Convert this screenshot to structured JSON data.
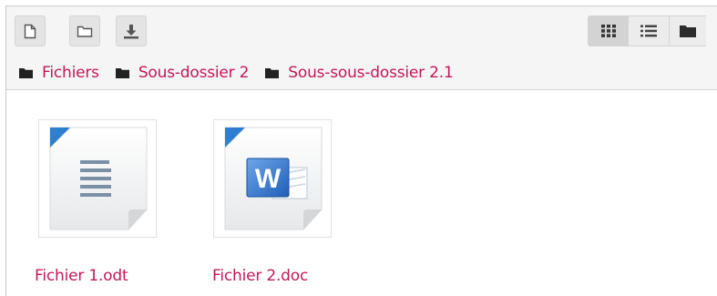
{
  "toolbar": {
    "buttons": [
      {
        "name": "add-file",
        "icon": "file-icon"
      },
      {
        "name": "create-folder",
        "icon": "folder-outline-icon"
      },
      {
        "name": "download",
        "icon": "download-icon"
      }
    ],
    "views": [
      {
        "name": "icons-view",
        "icon": "grid-icon",
        "active": true
      },
      {
        "name": "list-view",
        "icon": "list-icon",
        "active": false
      },
      {
        "name": "tree-view",
        "icon": "folder-solid-icon",
        "active": false
      }
    ]
  },
  "breadcrumb": [
    {
      "label": "Fichiers",
      "icon": "folder-icon"
    },
    {
      "label": "Sous-dossier 2",
      "icon": "folder-icon"
    },
    {
      "label": "Sous-sous-dossier 2.1",
      "icon": "folder-icon"
    }
  ],
  "files": [
    {
      "name": "Fichier 1.odt",
      "icon": "document-text-icon"
    },
    {
      "name": "Fichier 2.doc",
      "icon": "word-document-icon"
    }
  ],
  "colors": {
    "link": "#c2185b",
    "corner_ribbon": "#2f7fd1",
    "toolbar_bg": "#f5f5f5"
  }
}
